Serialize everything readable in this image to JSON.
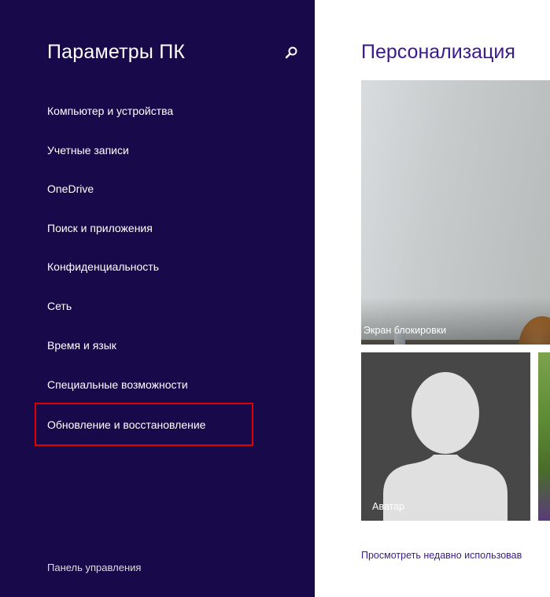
{
  "sidebar": {
    "title": "Параметры ПК",
    "search_icon": "search-icon",
    "items": [
      {
        "label": "Компьютер и устройства"
      },
      {
        "label": "Учетные записи"
      },
      {
        "label": "OneDrive"
      },
      {
        "label": "Поиск и приложения"
      },
      {
        "label": "Конфиденциальность"
      },
      {
        "label": "Сеть"
      },
      {
        "label": "Время и язык"
      },
      {
        "label": "Специальные возможности"
      },
      {
        "label": "Обновление и восстановление"
      }
    ],
    "control_panel": "Панель управления",
    "highlight_color": "#e00000",
    "background_color": "#180a4a"
  },
  "main": {
    "title": "Персонализация",
    "lock_screen_label": "Экран блокировки",
    "avatar_label": "Аватар",
    "history_link": "Просмотреть недавно использовав",
    "accent_color": "#3a1a8c"
  }
}
